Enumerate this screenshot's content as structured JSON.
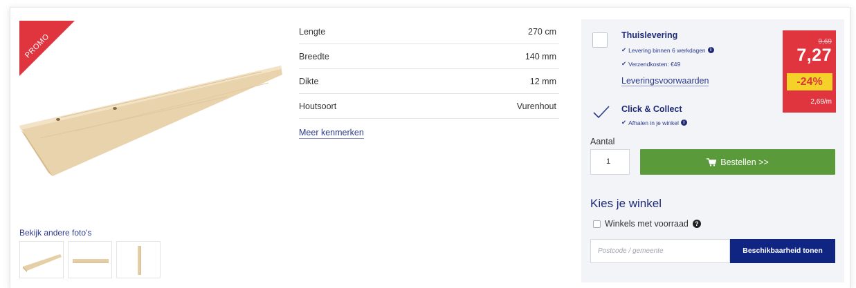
{
  "promo": {
    "label": "PROMO"
  },
  "photos": {
    "label": "Bekijk andere foto's"
  },
  "specs": {
    "rows": [
      {
        "label": "Lengte",
        "value": "270 cm"
      },
      {
        "label": "Breedte",
        "value": "140 mm"
      },
      {
        "label": "Dikte",
        "value": "12 mm"
      },
      {
        "label": "Houtsoort",
        "value": "Vurenhout"
      }
    ],
    "more_link": "Meer kenmerken"
  },
  "delivery": {
    "home": {
      "title": "Thuislevering",
      "line1": "Levering binnen 6 werkdagen",
      "line2": "Verzendkosten: €49",
      "conditions_link": "Leveringsvoorwaarden",
      "checked": false
    },
    "collect": {
      "title": "Click & Collect",
      "line1": "Afhalen in je winkel",
      "checked": true
    }
  },
  "price": {
    "old": "9,69",
    "current": "7,27",
    "discount": "-24%",
    "per_unit": "2,69/m",
    "color": "#e0343f",
    "discount_color": "#f4d22a"
  },
  "order": {
    "quantity_label": "Aantal",
    "quantity_value": "1",
    "button_label": "Bestellen >>",
    "button_color": "#5a9a3a"
  },
  "store": {
    "heading": "Kies je winkel",
    "stock_filter_label": "Winkels met voorraad",
    "postcode_placeholder": "Postcode / gemeente",
    "availability_button": "Beschikbaarheid tonen",
    "button_color": "#102582"
  }
}
